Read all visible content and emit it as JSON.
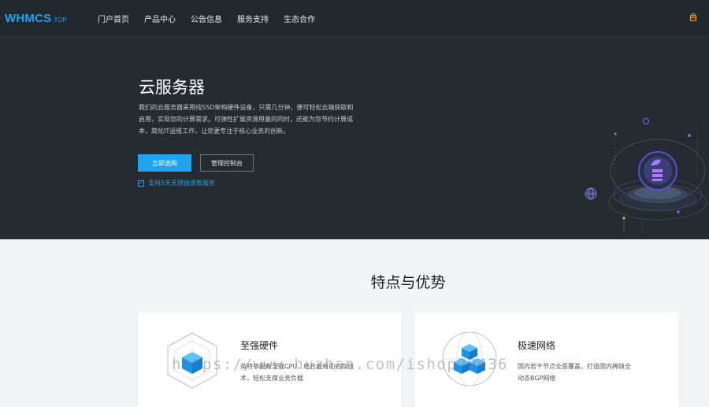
{
  "header": {
    "logo": {
      "main": "WHMCS",
      "sub": ".TOP"
    },
    "nav": [
      {
        "label": "门户首页"
      },
      {
        "label": "产品中心"
      },
      {
        "label": "公告信息"
      },
      {
        "label": "服务支持"
      },
      {
        "label": "生态合作"
      }
    ],
    "right_icon": "cart-icon"
  },
  "hero": {
    "title": "云服务器",
    "description": "我们的云服务器采用纯SSD架构硬件设备，只需几分钟，便可轻松云端获取和启用，实现您的计算需求。可弹性扩展资源用量的同时，还能为您节约计算成本，简化IT运维工作，让您更专注于核心业务的创新。",
    "buttons": {
      "buy": "立即选购",
      "console": "管理控制台"
    },
    "note": "支持5天无理由退款服务",
    "colors": {
      "accent": "#1ea4f0",
      "background": "#252b31"
    }
  },
  "features": {
    "title": "特点与优势",
    "cards": [
      {
        "title": "至强硬件",
        "description": "英特尔最新至强CPU，结合最新的内存技术，轻松支撑业务负载",
        "icon": "cube-hexagon-icon"
      },
      {
        "title": "极速网络",
        "description": "国内若干节点全面覆盖，打造国内稀缺全动态BGP网络",
        "icon": "network-globe-icon"
      }
    ]
  },
  "watermark": "https://www.huzhan.com/ishop29436"
}
